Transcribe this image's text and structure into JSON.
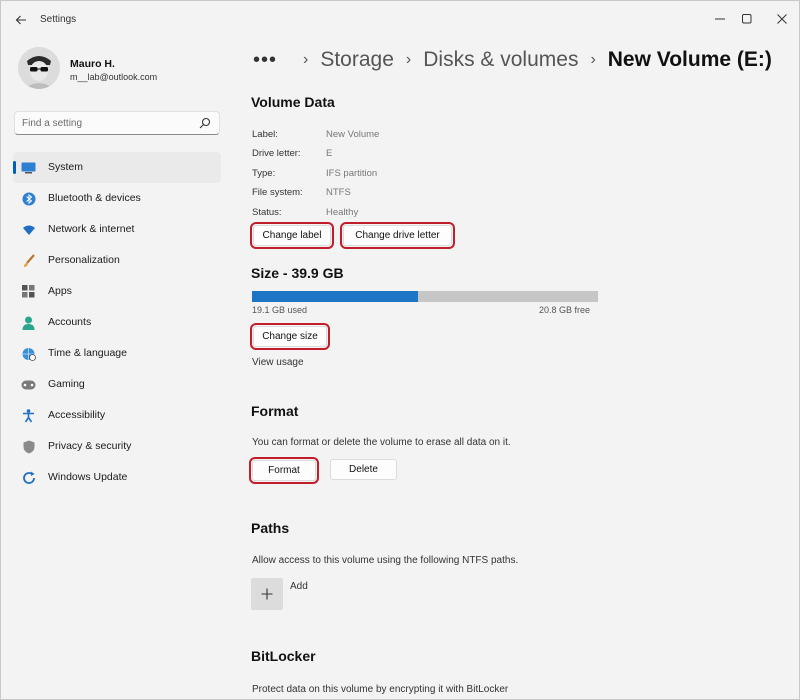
{
  "window": {
    "title": "Settings"
  },
  "profile": {
    "name": "Mauro H.",
    "email": "m__lab@outlook.com"
  },
  "search": {
    "placeholder": "Find a setting"
  },
  "nav": {
    "items": [
      {
        "label": "System",
        "icon": "system-display-icon",
        "active": true
      },
      {
        "label": "Bluetooth & devices",
        "icon": "bluetooth-icon"
      },
      {
        "label": "Network & internet",
        "icon": "wifi-icon"
      },
      {
        "label": "Personalization",
        "icon": "brush-icon"
      },
      {
        "label": "Apps",
        "icon": "apps-grid-icon"
      },
      {
        "label": "Accounts",
        "icon": "person-icon"
      },
      {
        "label": "Time & language",
        "icon": "globe-clock-icon"
      },
      {
        "label": "Gaming",
        "icon": "gamepad-icon"
      },
      {
        "label": "Accessibility",
        "icon": "accessibility-icon"
      },
      {
        "label": "Privacy & security",
        "icon": "shield-icon"
      },
      {
        "label": "Windows Update",
        "icon": "update-icon"
      }
    ]
  },
  "breadcrumb": {
    "more": "•••",
    "items": [
      "Storage",
      "Disks & volumes"
    ],
    "current": "New Volume (E:)"
  },
  "volume_data": {
    "title": "Volume Data",
    "rows": [
      {
        "label": "Label:",
        "value": "New Volume"
      },
      {
        "label": "Drive letter:",
        "value": "E"
      },
      {
        "label": "Type:",
        "value": "IFS partition"
      },
      {
        "label": "File system:",
        "value": "NTFS"
      },
      {
        "label": "Status:",
        "value": "Healthy"
      }
    ],
    "change_label_btn": "Change label",
    "change_letter_btn": "Change drive letter"
  },
  "size": {
    "title": "Size - 39.9 GB",
    "used": "19.1 GB used",
    "free": "20.8 GB free",
    "used_fraction": 0.479,
    "change_size_btn": "Change size",
    "view_usage": "View usage"
  },
  "format": {
    "title": "Format",
    "description": "You can format or delete the volume to erase all data on it.",
    "format_btn": "Format",
    "delete_btn": "Delete"
  },
  "paths": {
    "title": "Paths",
    "description": "Allow access to this volume using the following NTFS paths.",
    "add_label": "Add"
  },
  "bitlocker": {
    "title": "BitLocker",
    "description": "Protect data on this volume by encrypting it with BitLocker"
  },
  "colors": {
    "accent": "#005fb8",
    "bar_used": "#1d75c5",
    "bar_free": "#c6c6c6",
    "highlight": "#c21d2a"
  }
}
